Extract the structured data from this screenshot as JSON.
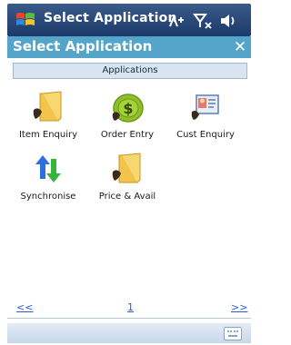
{
  "status_bar": {
    "title": "Select Application",
    "icons": [
      "windows-start-icon",
      "network-connection-icon",
      "signal-strength-icon",
      "speaker-volume-icon"
    ]
  },
  "title_bar": {
    "title": "Select Application",
    "close_label": "✕"
  },
  "section_header": "Applications",
  "applications": [
    {
      "label": "Item Enquiry",
      "icon": "folder-icon"
    },
    {
      "label": "Order Entry",
      "icon": "dollar-coin-icon"
    },
    {
      "label": "Cust Enquiry",
      "icon": "customer-card-icon"
    },
    {
      "label": "Synchronise",
      "icon": "sync-arrows-icon"
    },
    {
      "label": "Price & Avail",
      "icon": "folder-icon"
    }
  ],
  "pager": {
    "prev_label": "<<",
    "page": "1",
    "next_label": ">>"
  },
  "colors": {
    "status_bar": "#1b3a6a",
    "title_bar": "#55a4c9",
    "link": "#2a5bd7",
    "section_header_bg": "#d8e4f0"
  }
}
